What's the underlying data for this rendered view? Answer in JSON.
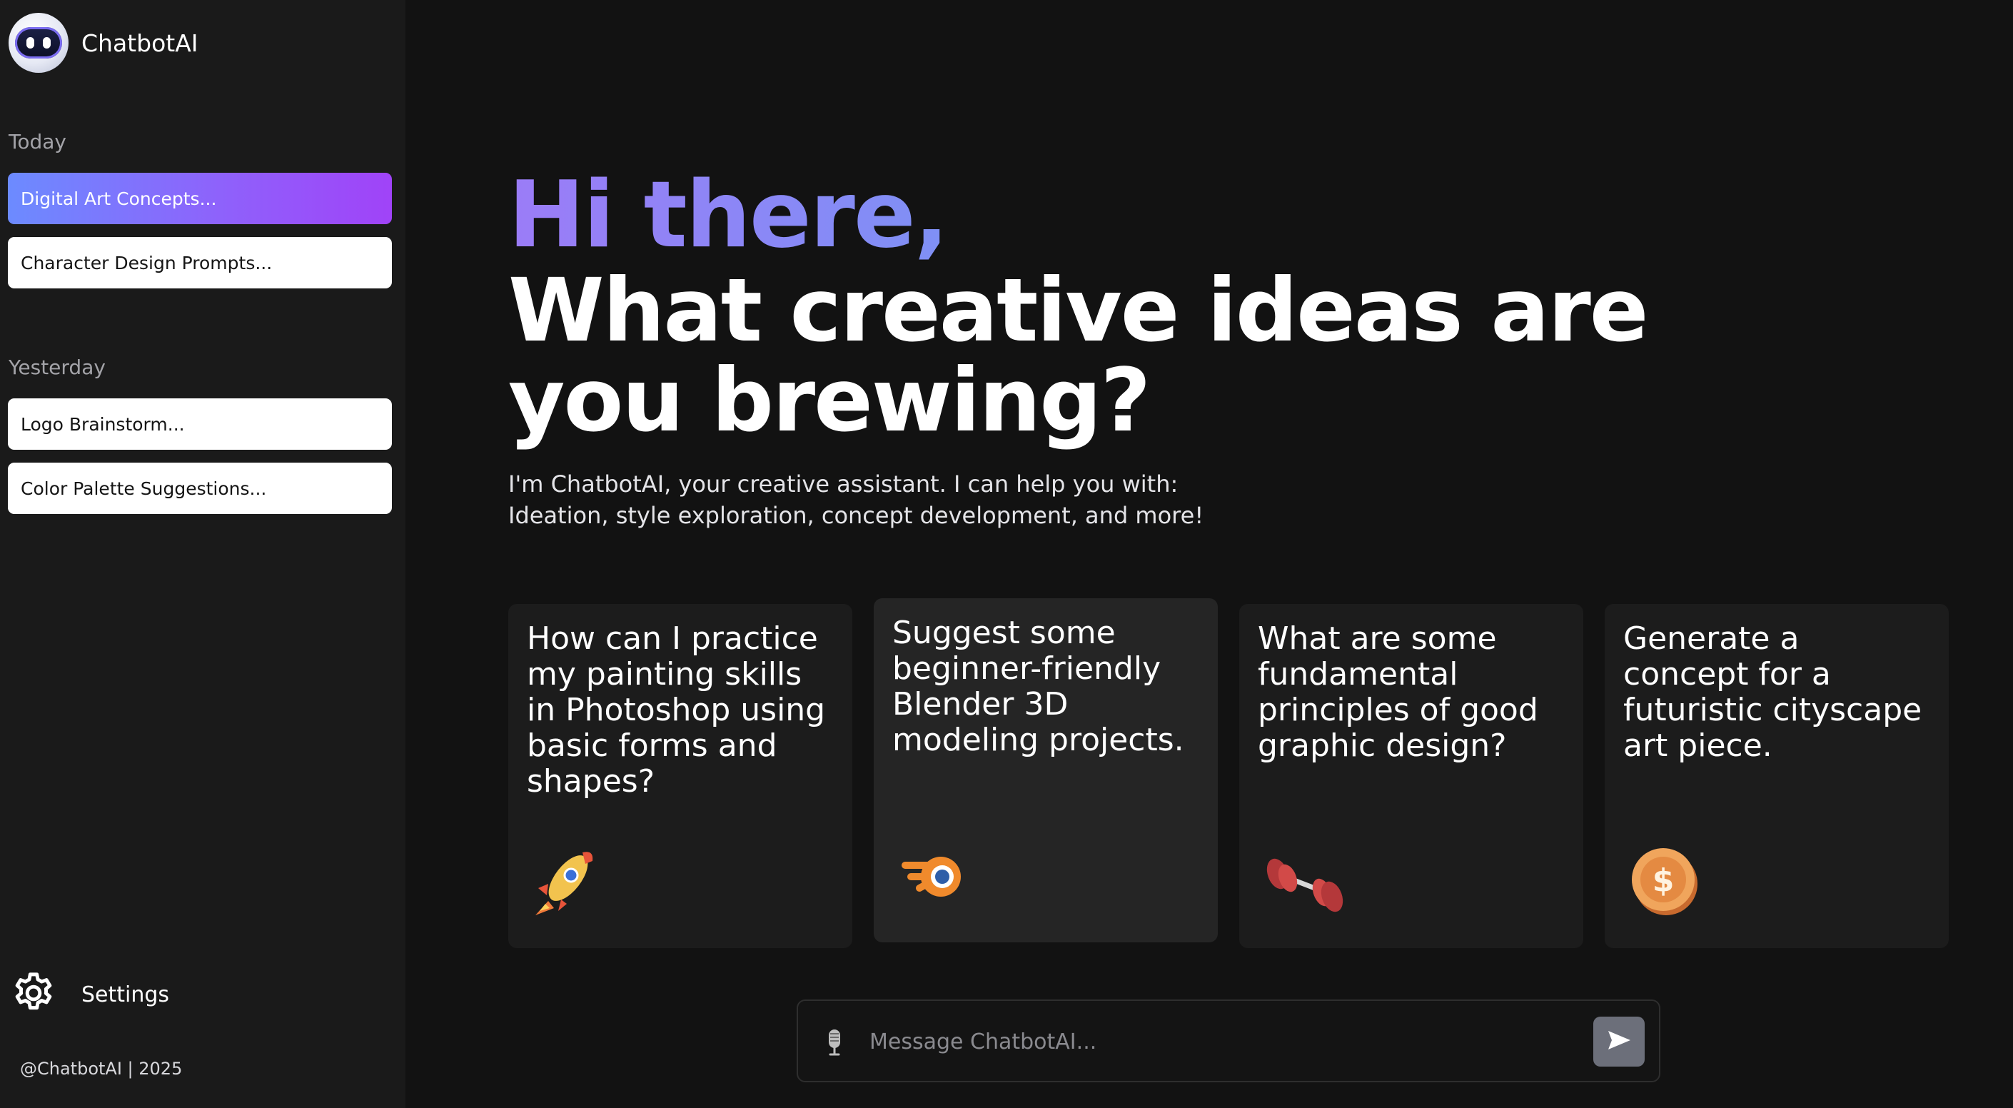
{
  "brand": {
    "name": "ChatbotAI"
  },
  "sidebar": {
    "sections": [
      {
        "label": "Today",
        "items": [
          {
            "label": "Digital Art Concepts...",
            "active": true
          },
          {
            "label": "Character Design Prompts..."
          }
        ]
      },
      {
        "label": "Yesterday",
        "items": [
          {
            "label": "Logo Brainstorm..."
          },
          {
            "label": "Color Palette Suggestions..."
          }
        ]
      }
    ],
    "settings_label": "Settings",
    "footer": "@ChatbotAI | 2025"
  },
  "hero": {
    "greeting": "Hi there,",
    "headline": "What creative ideas are you brewing?",
    "intro_line1": "I'm ChatbotAI, your creative assistant. I can help you with:",
    "intro_line2": "Ideation, style exploration, concept development, and more!"
  },
  "cards": [
    {
      "text": "How can I practice my painting skills in Photoshop using basic forms and shapes?",
      "icon": "rocket-icon"
    },
    {
      "text": "Suggest some beginner-friendly Blender 3D modeling projects.",
      "icon": "blender-icon"
    },
    {
      "text": "What are some fundamental principles of good graphic design?",
      "icon": "dumbbell-icon"
    },
    {
      "text": "Generate a concept for a futuristic cityscape art piece.",
      "icon": "coin-icon"
    }
  ],
  "composer": {
    "placeholder": "Message ChatbotAI..."
  },
  "colors": {
    "accent_start": "#6c8bff",
    "accent_end": "#a043f8",
    "background": "#121212",
    "sidebar": "#1a1a1a"
  }
}
